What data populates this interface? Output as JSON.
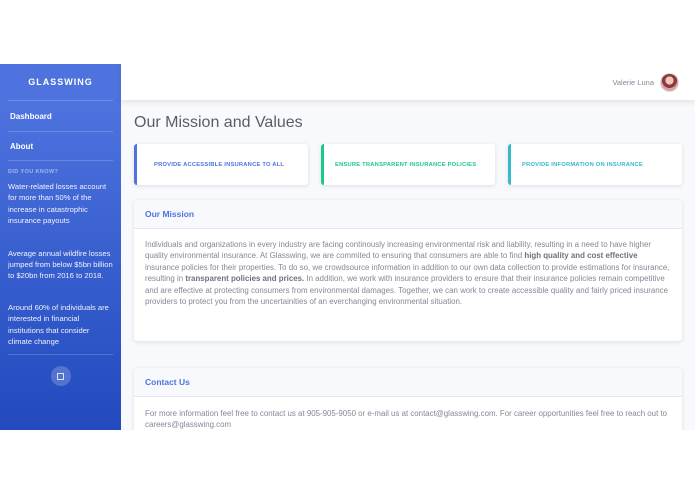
{
  "sidebar": {
    "brand": "GLASSWING",
    "nav": [
      {
        "label": "Dashboard"
      },
      {
        "label": "About"
      }
    ],
    "heading": "DID YOU KNOW?",
    "facts": [
      "Water-related losses account for more than 50% of the increase in catastrophic insurance payouts",
      "Average annual wildfire losses jumped from below $5bn billion to $20bn from 2016 to 2018.",
      "Around 60% of individuals are interested in financial institutions that consider climate change"
    ]
  },
  "topbar": {
    "user_name": "Valerie Luna"
  },
  "main": {
    "title": "Our Mission and Values",
    "values": [
      {
        "label": "PROVIDE ACCESSIBLE INSURANCE TO ALL",
        "color": "#4e73df"
      },
      {
        "label": "ENSURE TRANSPARENT INSURANCE POLICIES",
        "color": "#1cc88a"
      },
      {
        "label": "PROVIDE INFORMATION ON INSURANCE",
        "color": "#36b9cc"
      }
    ],
    "mission": {
      "header": "Our Mission",
      "text_1": "Individuals and organizations in every industry are facing continously increasing environmental risk and liability, resulting in a need to have higher quality environmental insurance. At Glasswing, we are commited to ensuring that consumers are able to find ",
      "bold_1": "high quality and cost effective",
      "text_2": " insurance policies for their properties. To do so, we crowdsource information in addition to our own data collection to provide estimations for insurance, resulting in ",
      "bold_2": "transparent policies and prices.",
      "text_3": " In addition, we work with insurance providers to ensure that their insurance policies remain competitive and are effective at protecting consumers from environmental damages. Together, we can work to create accessible quality and fairly priced insurance providers to protect you from the uncertainities of an everchanging environmental situation."
    },
    "contact": {
      "header": "Contact Us",
      "text": "For more information feel free to contact us at 905-905-9050 or e-mail us at contact@glasswing.com. For career opportunities feel free to reach out to careers@glasswing.com"
    }
  },
  "colors": {
    "primary": "#4e73df",
    "success": "#1cc88a",
    "info": "#36b9cc"
  }
}
